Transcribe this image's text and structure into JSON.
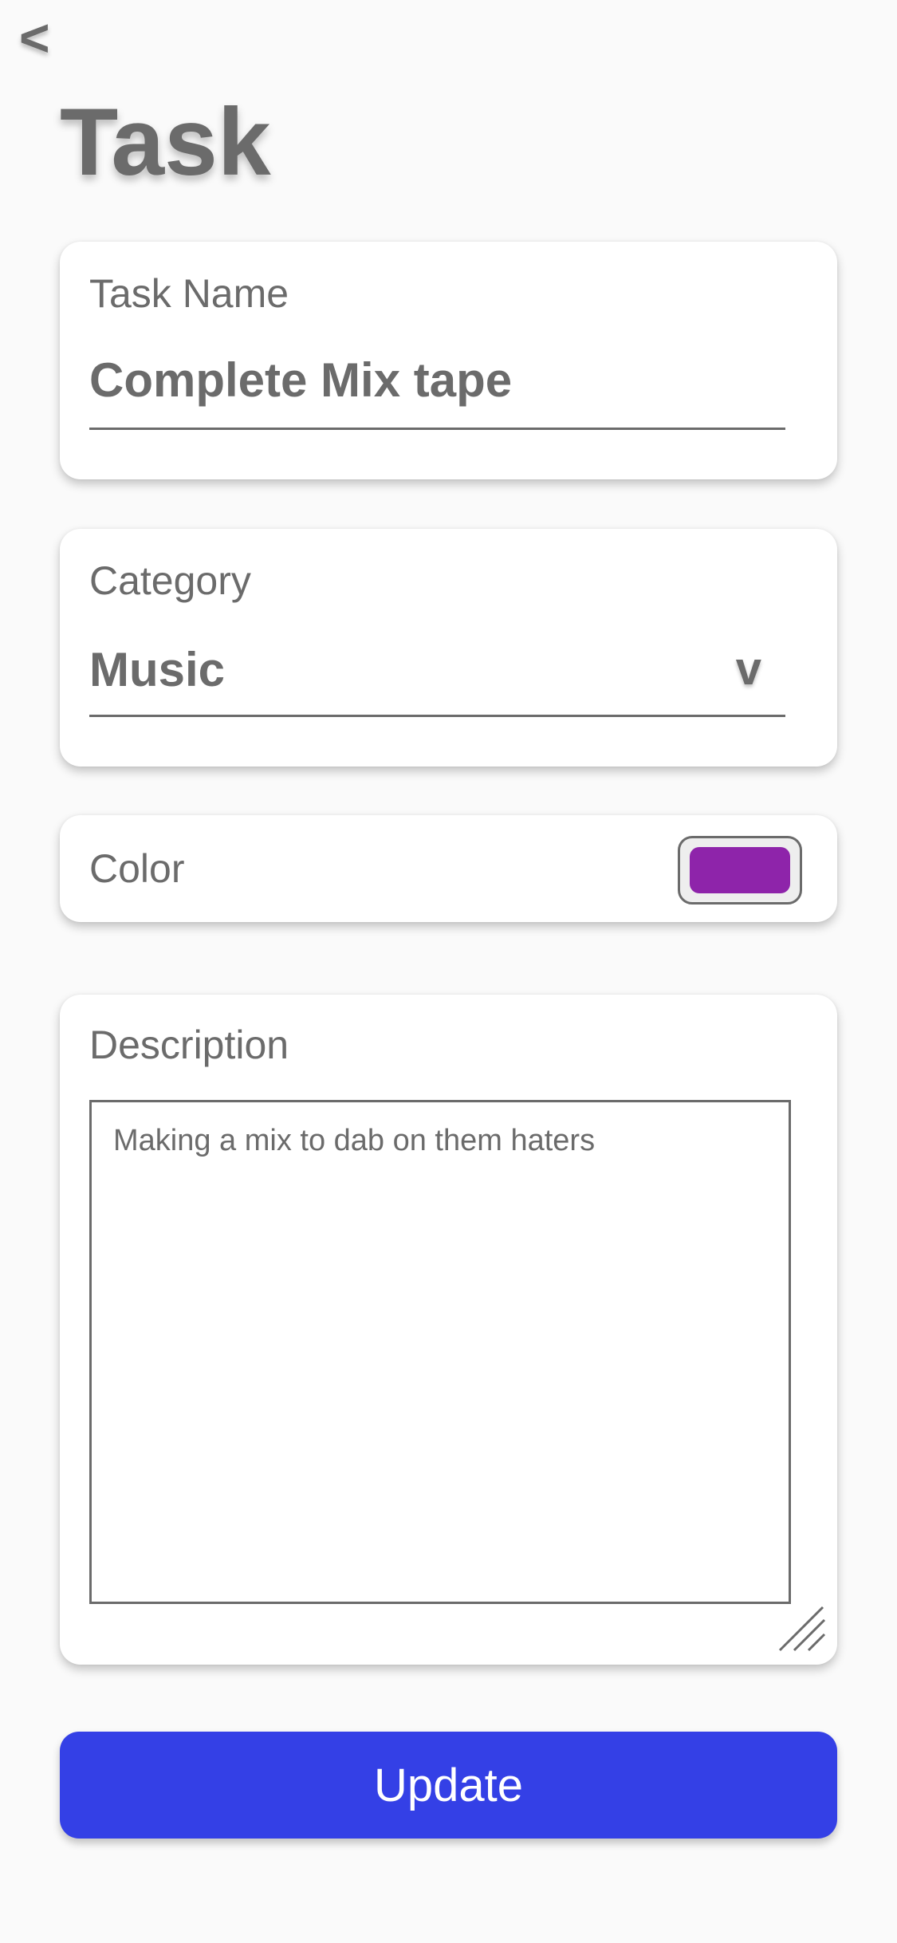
{
  "header": {
    "back_label": "<",
    "title": "Task"
  },
  "task_name": {
    "label": "Task Name",
    "value": "Complete Mix tape"
  },
  "category": {
    "label": "Category",
    "value": "Music",
    "chevron": "v"
  },
  "color": {
    "label": "Color",
    "swatch_color": "#8e24aa"
  },
  "description": {
    "label": "Description",
    "value": "Making a mix to dab on them haters"
  },
  "update_button": {
    "label": "Update",
    "color": "#3440e6"
  },
  "icons": {
    "back": "chevron-left-icon",
    "dropdown": "chevron-down-icon",
    "resize": "resize-handle-icon"
  }
}
